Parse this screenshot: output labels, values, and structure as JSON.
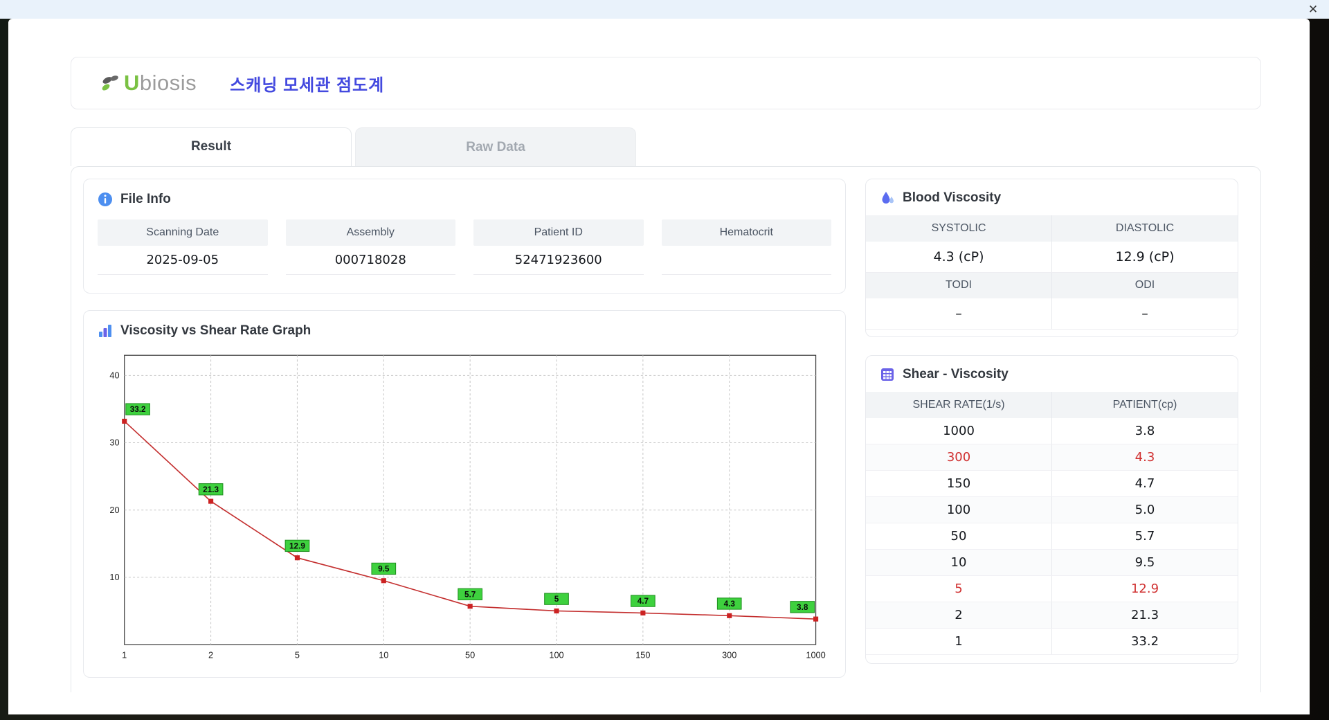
{
  "window": {
    "close_label": "✕"
  },
  "header": {
    "brand_u": "U",
    "brand_rest": "biosis",
    "title": "스캐닝 모세관 점도계"
  },
  "tabs": [
    {
      "label": "Result",
      "active": true
    },
    {
      "label": "Raw Data",
      "active": false
    }
  ],
  "file_info": {
    "heading": "File Info",
    "fields": [
      {
        "label": "Scanning Date",
        "value": "2025-09-05"
      },
      {
        "label": "Assembly",
        "value": "000718028"
      },
      {
        "label": "Patient ID",
        "value": "52471923600"
      },
      {
        "label": "Hematocrit",
        "value": ""
      }
    ]
  },
  "blood_viscosity": {
    "heading": "Blood Viscosity",
    "rows": [
      {
        "labels": [
          "SYSTOLIC",
          "DIASTOLIC"
        ],
        "values": [
          "4.3 (cP)",
          "12.9 (cP)"
        ]
      },
      {
        "labels": [
          "TODI",
          "ODI"
        ],
        "values": [
          "–",
          "–"
        ]
      }
    ]
  },
  "graph": {
    "heading": "Viscosity vs Shear Rate Graph"
  },
  "chart_data": {
    "type": "line",
    "title": "Viscosity vs Shear Rate Graph",
    "x_scale": "categorical",
    "categories": [
      "1",
      "2",
      "5",
      "10",
      "50",
      "100",
      "150",
      "300",
      "1000"
    ],
    "values": [
      33.2,
      21.3,
      12.9,
      9.5,
      5.7,
      5,
      4.7,
      4.3,
      3.8
    ],
    "point_labels": [
      "33.2",
      "21.3",
      "12.9",
      "9.5",
      "5.7",
      "5",
      "4.7",
      "4.3",
      "3.8"
    ],
    "y_ticks": [
      10,
      20,
      30,
      40
    ],
    "ylim": [
      0,
      43
    ],
    "grid": true,
    "line_color": "#c43030",
    "point_color": "#cc2222",
    "label_bg": "#3ed13e",
    "label_border": "#1f8f1f"
  },
  "shear_table": {
    "heading": "Shear - Viscosity",
    "columns": [
      "SHEAR RATE(1/s)",
      "PATIENT(cp)"
    ],
    "rows": [
      {
        "shear": "1000",
        "patient": "3.8",
        "highlight": false
      },
      {
        "shear": "300",
        "patient": "4.3",
        "highlight": true
      },
      {
        "shear": "150",
        "patient": "4.7",
        "highlight": false
      },
      {
        "shear": "100",
        "patient": "5.0",
        "highlight": false
      },
      {
        "shear": "50",
        "patient": "5.7",
        "highlight": false
      },
      {
        "shear": "10",
        "patient": "9.5",
        "highlight": false
      },
      {
        "shear": "5",
        "patient": "12.9",
        "highlight": true
      },
      {
        "shear": "2",
        "patient": "21.3",
        "highlight": false
      },
      {
        "shear": "1",
        "patient": "33.2",
        "highlight": false
      }
    ]
  },
  "colors": {
    "accent_blue": "#4d8ff0",
    "accent_purple": "#6b63e8",
    "title_blue": "#4349df",
    "highlight_red": "#d03030",
    "chart_green": "#3ed13e"
  }
}
